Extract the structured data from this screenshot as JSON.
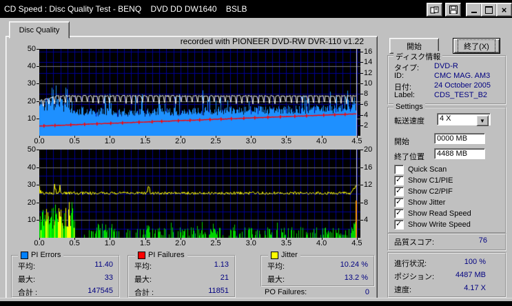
{
  "titlebar": {
    "title": "CD Speed : Disc Quality Test - BENQ    DVD DD DW1640    BSLB",
    "icons": [
      "report-icon",
      "save-icon",
      "minimize-icon",
      "maximize-icon",
      "close-icon"
    ]
  },
  "tabs": {
    "disc_quality": "Disc Quality"
  },
  "recorded_with": "recorded with PIONEER DVD-RW  DVR-110  v1.22",
  "actions": {
    "start": "開始",
    "exit": "終了(X)"
  },
  "disc_info": {
    "title": "ディスク情報",
    "rows": [
      {
        "label": "タイプ:",
        "value": "DVD-R"
      },
      {
        "label": "ID:",
        "value": "CMC MAG. AM3"
      },
      {
        "label": "日付:",
        "value": "24 October 2005"
      },
      {
        "label": "Label:",
        "value": "CDS_TEST_B2"
      }
    ]
  },
  "settings": {
    "title": "Settings",
    "speed": {
      "label": "転送速度",
      "value": "4 X"
    },
    "start": {
      "label": "開始",
      "value": "0000 MB"
    },
    "end": {
      "label": "終了位置",
      "value": "4488 MB"
    },
    "checkboxes": [
      {
        "label": "Quick Scan",
        "checked": false
      },
      {
        "label": "Show C1/PIE",
        "checked": true
      },
      {
        "label": "Show C2/PIF",
        "checked": true
      },
      {
        "label": "Show Jitter",
        "checked": true
      },
      {
        "label": "Show Read Speed",
        "checked": true
      },
      {
        "label": "Show Write Speed",
        "checked": true
      }
    ]
  },
  "quality_score": {
    "label": "品質スコア:",
    "value": "76"
  },
  "progress": {
    "rows": [
      {
        "label": "進行状況:",
        "value": "100 %"
      },
      {
        "label": "ポジション:",
        "value": "4487 MB"
      },
      {
        "label": "速度:",
        "value": "4.17 X"
      }
    ]
  },
  "stats": {
    "pi_errors": {
      "title": "PI Errors",
      "swatch": "#0080ff",
      "rows": [
        {
          "label": "平均:",
          "value": "11.40"
        },
        {
          "label": "最大:",
          "value": "33"
        },
        {
          "label": "合計 :",
          "value": "147545"
        }
      ]
    },
    "pi_failures": {
      "title": "PI Failures",
      "swatch": "#ff0000",
      "rows": [
        {
          "label": "平均:",
          "value": "1.13"
        },
        {
          "label": "最大:",
          "value": "21"
        },
        {
          "label": "合計 :",
          "value": "11851"
        }
      ]
    },
    "jitter": {
      "title": "Jitter",
      "swatch": "#ffff00",
      "rows": [
        {
          "label": "平均:",
          "value": "10.24 %"
        },
        {
          "label": "最大:",
          "value": "13.2 %"
        }
      ]
    },
    "po_failures": {
      "label": "PO Failures:",
      "value": "0"
    }
  },
  "chart_data": [
    {
      "type": "area",
      "name": "pi-errors-speed-chart",
      "title": "recorded with PIONEER DVD-RW  DVR-110  v1.22",
      "x_unit": "GB",
      "x_range": [
        0,
        4.55
      ],
      "x_ticks": [
        "0.0",
        "0.5",
        "1.0",
        "1.5",
        "2.0",
        "2.5",
        "3.0",
        "3.5",
        "4.0",
        "4.5"
      ],
      "left_axis": {
        "range": [
          0,
          50
        ],
        "ticks": [
          50,
          40,
          30,
          20,
          10
        ]
      },
      "right_axis": {
        "range": [
          0,
          16.53
        ],
        "ticks": [
          16,
          14,
          12,
          10,
          8,
          6,
          4,
          2
        ]
      },
      "data_end_gb": 4.488,
      "background": "#000000",
      "grid_colors": {
        "vertical": "#000095",
        "minor_h": "#000095",
        "major_h": "#787878"
      },
      "series": [
        {
          "name": "PI Errors",
          "style": "bars",
          "color": "#1e90ff",
          "mean": 11.4,
          "max": 33,
          "total": 147545
        },
        {
          "name": "Write Speed",
          "style": "line",
          "color": "#ffffff",
          "approx_level_x": 8,
          "pattern": "sawtooth dips"
        },
        {
          "name": "Read Speed",
          "style": "line",
          "color": "#ff0000",
          "start_x": 2.0,
          "end_x": 4.17
        }
      ],
      "end_marker_color": "#d8d8d8"
    },
    {
      "type": "area",
      "name": "pi-failures-jitter-chart",
      "x_unit": "GB",
      "x_range": [
        0,
        4.55
      ],
      "x_ticks": [
        "0.0",
        "0.5",
        "1.0",
        "1.5",
        "2.0",
        "2.5",
        "3.0",
        "3.5",
        "4.0",
        "4.5"
      ],
      "left_axis": {
        "range": [
          0,
          50
        ],
        "ticks": [
          50,
          40,
          30,
          20,
          10
        ]
      },
      "right_axis": {
        "range": [
          0,
          20
        ],
        "ticks": [
          20,
          16,
          12,
          8,
          4
        ]
      },
      "data_end_gb": 4.488,
      "background": "#000000",
      "grid_colors": {
        "vertical": "#000095",
        "minor_h": "#000095",
        "major_h": "#787878"
      },
      "series": [
        {
          "name": "PI Failures",
          "style": "bars",
          "color": "#00d400",
          "alt_color": "#ffff00",
          "mean": 1.13,
          "max": 21,
          "total": 11851
        },
        {
          "name": "Jitter",
          "style": "line",
          "color": "#ffff00",
          "mean_pct": 10.24,
          "max_pct": 13.2
        }
      ],
      "end_marker_color": "#d8d8d8",
      "end_spike_color": "#ff9900"
    }
  ]
}
